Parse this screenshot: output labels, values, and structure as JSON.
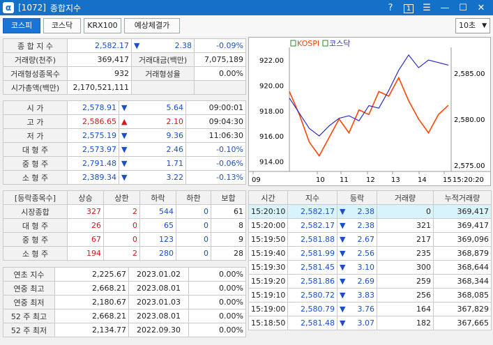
{
  "window": {
    "code": "[1072]",
    "title": "종합지수",
    "ctrl_help": "?",
    "ctrl_one": "1",
    "ctrl_menu": "☰",
    "ctrl_min": "—",
    "ctrl_max": "☐",
    "ctrl_close": "✕"
  },
  "tabs": [
    "코스피",
    "코스닥",
    "KRX100",
    "예상체결가"
  ],
  "interval": "10초",
  "summary": {
    "r1": {
      "l": "종 합 지 수",
      "v": "2,582.17",
      "arrow": "▼",
      "chg": "2.38",
      "pct": "-0.09%"
    },
    "r2": {
      "l": "거래량(천주)",
      "v": "369,417",
      "l2": "거래대금(백만)",
      "v2": "7,075,189"
    },
    "r3": {
      "l": "거래형성종목수",
      "v": "932",
      "l2": "거래형성율",
      "v2": "0.00%"
    },
    "r4": {
      "l": "시가총액(백만)",
      "v": "2,170,521,111"
    }
  },
  "ohlc": [
    {
      "l": "시 가",
      "v": "2,578.91",
      "arrow": "▼",
      "chg": "5.64",
      "t": "09:00:01",
      "vc": "blue"
    },
    {
      "l": "고 가",
      "v": "2,586.65",
      "arrow": "▲",
      "chg": "2.10",
      "t": "09:04:30",
      "vc": "red"
    },
    {
      "l": "저 가",
      "v": "2,575.19",
      "arrow": "▼",
      "chg": "9.36",
      "t": "11:06:30",
      "vc": "blue"
    },
    {
      "l": "대 형 주",
      "v": "2,573.97",
      "arrow": "▼",
      "chg": "2.46",
      "t": "-0.10%",
      "vc": "blue"
    },
    {
      "l": "중 형 주",
      "v": "2,791.48",
      "arrow": "▼",
      "chg": "1.71",
      "t": "-0.06%",
      "vc": "blue"
    },
    {
      "l": "소 형 주",
      "v": "2,389.34",
      "arrow": "▼",
      "chg": "3.22",
      "t": "-0.13%",
      "vc": "blue"
    }
  ],
  "updown": {
    "headers": [
      "[등락종목수]",
      "상승",
      "상한",
      "하락",
      "하한",
      "보합"
    ],
    "rows": [
      {
        "l": "시장종합",
        "up": "327",
        "uplim": "2",
        "down": "544",
        "downlim": "0",
        "flat": "61"
      },
      {
        "l": "대 형 주",
        "up": "26",
        "uplim": "0",
        "down": "65",
        "downlim": "0",
        "flat": "8"
      },
      {
        "l": "중 형 주",
        "up": "67",
        "uplim": "0",
        "down": "123",
        "downlim": "0",
        "flat": "9"
      },
      {
        "l": "소 형 주",
        "up": "194",
        "uplim": "2",
        "down": "280",
        "downlim": "0",
        "flat": "28"
      }
    ]
  },
  "yearly": [
    {
      "l": "연초 지수",
      "v": "2,225.67",
      "d": "2023.01.02",
      "p": "0.00%"
    },
    {
      "l": "연중 최고",
      "v": "2,668.21",
      "d": "2023.08.01",
      "p": "0.00%"
    },
    {
      "l": "연중 최저",
      "v": "2,180.67",
      "d": "2023.01.03",
      "p": "0.00%"
    },
    {
      "l": "52 주 최고",
      "v": "2,668.21",
      "d": "2023.08.01",
      "p": "0.00%"
    },
    {
      "l": "52 주 최저",
      "v": "2,134.77",
      "d": "2022.09.30",
      "p": "0.00%"
    }
  ],
  "ticks": {
    "headers": [
      "시간",
      "지수",
      "등락",
      "거래량",
      "누적거래량"
    ],
    "rows": [
      {
        "t": "15:20:10",
        "v": "2,582.17",
        "a": "▼",
        "c": "2.38",
        "vol": "0",
        "cum": "369,417"
      },
      {
        "t": "15:20:00",
        "v": "2,582.17",
        "a": "▼",
        "c": "2.38",
        "vol": "321",
        "cum": "369,417"
      },
      {
        "t": "15:19:50",
        "v": "2,581.88",
        "a": "▼",
        "c": "2.67",
        "vol": "217",
        "cum": "369,096"
      },
      {
        "t": "15:19:40",
        "v": "2,581.99",
        "a": "▼",
        "c": "2.56",
        "vol": "235",
        "cum": "368,879"
      },
      {
        "t": "15:19:30",
        "v": "2,581.45",
        "a": "▼",
        "c": "3.10",
        "vol": "300",
        "cum": "368,644"
      },
      {
        "t": "15:19:20",
        "v": "2,581.86",
        "a": "▼",
        "c": "2.69",
        "vol": "259",
        "cum": "368,344"
      },
      {
        "t": "15:19:10",
        "v": "2,580.72",
        "a": "▼",
        "c": "3.83",
        "vol": "256",
        "cum": "368,085"
      },
      {
        "t": "15:19:00",
        "v": "2,580.79",
        "a": "▼",
        "c": "3.76",
        "vol": "164",
        "cum": "367,829"
      },
      {
        "t": "15:18:50",
        "v": "2,581.48",
        "a": "▼",
        "c": "3.07",
        "vol": "182",
        "cum": "367,665"
      }
    ]
  },
  "chart_data": {
    "type": "line",
    "legend": [
      "KOSPI",
      "코스닥"
    ],
    "left_axis": {
      "ticks": [
        "922.00",
        "920.00",
        "918.00",
        "916.00",
        "914.00"
      ]
    },
    "right_axis": {
      "ticks": [
        "2,585.00",
        "2,580.00",
        "2,575.00"
      ]
    },
    "x_ticks": [
      "09",
      "10",
      "11",
      "12",
      "13",
      "14",
      "15"
    ],
    "end_label": "15:20:20",
    "series": [
      {
        "name": "KOSPI",
        "color": "#ff4400",
        "values": [
          2583,
          2580.5,
          2577.5,
          2576,
          2578,
          2580,
          2578.5,
          2581,
          2580.5,
          2583,
          2582.5,
          2584.5,
          2582,
          2580,
          2578.5,
          2580.5,
          2581.5
        ]
      },
      {
        "name": "코스닥",
        "color": "#2a2acc",
        "values": [
          919.0,
          917.8,
          916.6,
          916.0,
          916.8,
          917.4,
          917.6,
          917.2,
          918.4,
          918.2,
          919.6,
          921.2,
          922.4,
          921.4,
          922.0,
          921.8,
          921.6
        ]
      }
    ]
  },
  "colors": {
    "accent": "#1570c8",
    "up": "#d01a1a",
    "down": "#1a4fc8",
    "highlight": "#d9f3fb"
  }
}
